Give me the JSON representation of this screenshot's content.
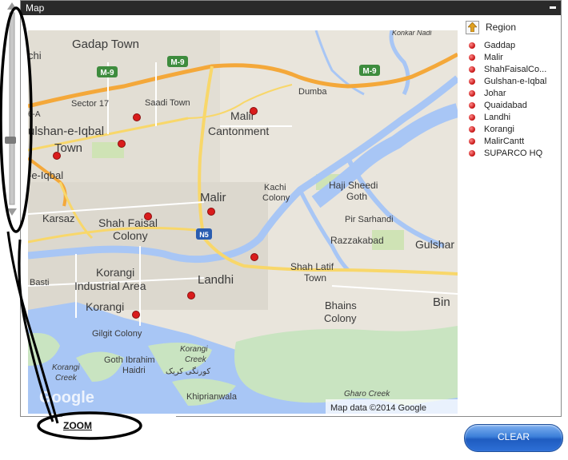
{
  "window": {
    "title": "Map"
  },
  "legend": {
    "header": "Region",
    "items": [
      "Gaddap",
      "Malir",
      "ShahFaisalCo...",
      "Gulshan-e-Iqbal",
      "Johar",
      "Quaidabad",
      "Landhi",
      "Korangi",
      "MalirCantt",
      "SUPARCO HQ"
    ]
  },
  "map": {
    "attribution": "Map data ©2014 Google",
    "logo": "Google",
    "places": {
      "gadap_town": "Gadap Town",
      "chi": "chi",
      "sector17": "Sector 17",
      "saadi_town": "Saadi Town",
      "malir_cantonment_1": "Malir",
      "malir_cantonment_2": "Cantonment",
      "dumba": "Dumba",
      "konkar_nadi": "Konkar Nadi",
      "gulshan_1": "ulshan-e-Iqbal",
      "gulshan_2": "Town",
      "e_iqbal": "-e-Iqbal",
      "block_6a": "6-A",
      "kachi_colony_1": "Kachi",
      "kachi_colony_2": "Colony",
      "haji_sheedi_1": "Haji Sheedi",
      "haji_sheedi_2": "Goth",
      "malir": "Malir",
      "karsaz": "Karsaz",
      "shah_faisal_1": "Shah Faisal",
      "shah_faisal_2": "Colony",
      "pir_sarhandi": "Pir Sarhandi",
      "razzakabad": "Razzakabad",
      "gulshan_east": "Gulshar",
      "shah_latif_1": "Shah Latif",
      "shah_latif_2": "Town",
      "korangi_industrial_1": "Korangi",
      "korangi_industrial_2": "Industrial Area",
      "landhi": "Landhi",
      "basti": "Basti",
      "korangi": "Korangi",
      "gilgit_colony": "Gilgit Colony",
      "bhains_colony_1": "Bhains",
      "bhains_colony_2": "Colony",
      "bin": "Bin",
      "korangi_creek_1": "Korangi",
      "korangi_creek_2": "Creek",
      "korangi_creek_urdu": "کورنگی کریک",
      "goth_ibrahim_1": "Goth Ibrahim",
      "goth_ibrahim_2": "Haidri",
      "korangi_creek_w1": "Korangi",
      "korangi_creek_w2": "Creek",
      "khiprianwala": "Khiprianwala",
      "gharo_creek": "Gharo Creek"
    },
    "shields": {
      "m9_west": "M-9",
      "m9_center": "M-9",
      "m9_east": "M-9",
      "n5": "N5"
    }
  },
  "buttons": {
    "clear": "CLEAR"
  },
  "annotation": {
    "zoom": "ZOOM"
  }
}
